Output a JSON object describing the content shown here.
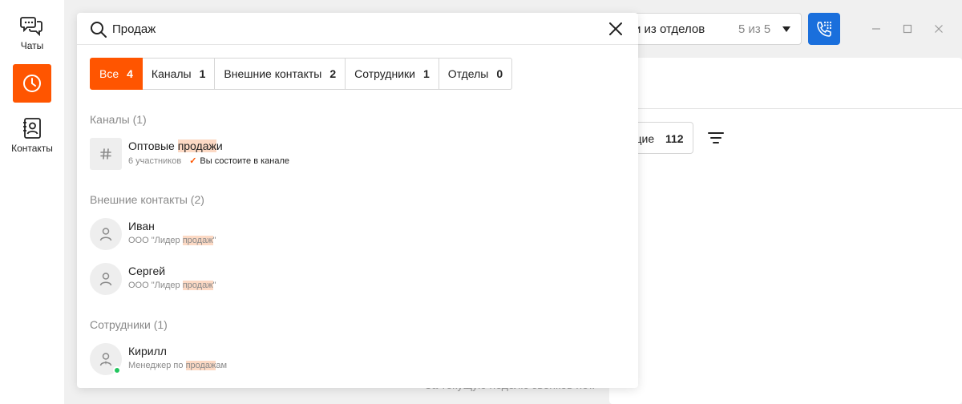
{
  "nav": {
    "chats_label": "Чаты",
    "contacts_label": "Контакты",
    "active_color": "#ff5500"
  },
  "background": {
    "dept_select_text": "и из отделов",
    "dept_select_count": "5 из 5",
    "filter_label": "щие",
    "filter_count": "112",
    "empty_text": "За текущую неделю звонков нет."
  },
  "search": {
    "value": "Продаж",
    "query": "продаж"
  },
  "tabs": [
    {
      "label": "Все",
      "count": "4",
      "active": true
    },
    {
      "label": "Каналы",
      "count": "1",
      "active": false
    },
    {
      "label": "Внешние контакты",
      "count": "2",
      "active": false
    },
    {
      "label": "Сотрудники",
      "count": "1",
      "active": false
    },
    {
      "label": "Отделы",
      "count": "0",
      "active": false
    }
  ],
  "sections": {
    "channels": "Каналы (1)",
    "external": "Внешние контакты (2)",
    "employees": "Сотрудники (1)"
  },
  "results": {
    "channel": {
      "name_before": "Оптовые ",
      "name_match": "продаж",
      "name_after": "и",
      "members": "6 участников",
      "member_status": "Вы состоите в канале"
    },
    "external": [
      {
        "name": "Иван",
        "sub_before": "ООО \"Лидер ",
        "sub_match": "продаж",
        "sub_after": "\""
      },
      {
        "name": "Сергей",
        "sub_before": "ООО \"Лидер ",
        "sub_match": "продаж",
        "sub_after": "\""
      }
    ],
    "employee": {
      "name": "Кирилл",
      "sub_before": "Менеджер по ",
      "sub_match": "продаж",
      "sub_after": "ам",
      "online": true
    }
  }
}
